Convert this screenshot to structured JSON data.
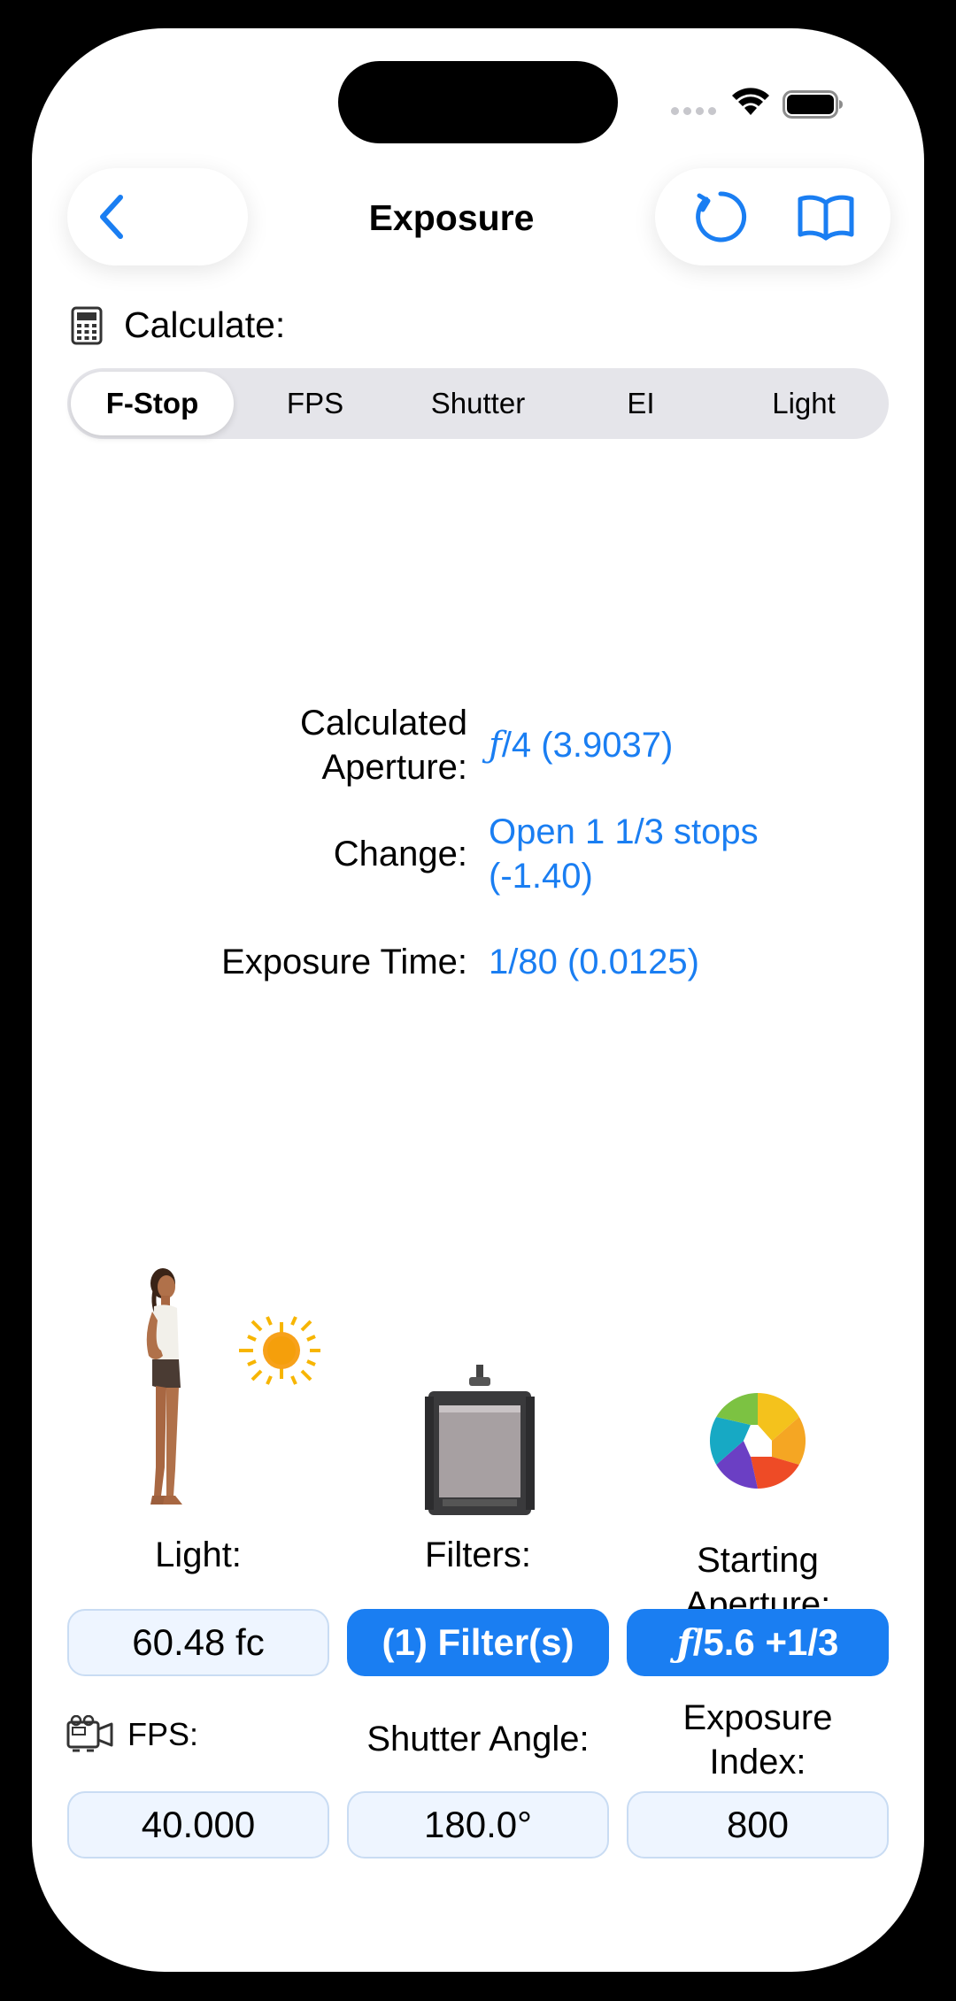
{
  "status_bar": {
    "signal_icon": "cellular-signal-icon",
    "wifi_icon": "wifi-icon",
    "battery_icon": "battery-icon"
  },
  "nav": {
    "title": "Exposure",
    "back_icon": "chevron-left-icon",
    "reset_icon": "reset-icon",
    "book_icon": "book-icon"
  },
  "calculate": {
    "label": "Calculate:",
    "icon": "calculator-icon"
  },
  "tabs": [
    {
      "label": "F-Stop",
      "selected": true
    },
    {
      "label": "FPS",
      "selected": false
    },
    {
      "label": "Shutter",
      "selected": false
    },
    {
      "label": "EI",
      "selected": false
    },
    {
      "label": "Light",
      "selected": false
    }
  ],
  "results": {
    "aperture_label_1": "Calculated",
    "aperture_label_2": "Aperture:",
    "aperture_f": "ƒ",
    "aperture_value": "/4 (3.9037)",
    "change_label": "Change:",
    "change_value_1": "Open 1 1/3 stops",
    "change_value_2": "(-1.40)",
    "exposure_time_label": "Exposure Time:",
    "exposure_time_value": "1/80 (0.0125)"
  },
  "inputs": {
    "light_label": "Light:",
    "light_value": "60.48 fc",
    "filters_label": "Filters:",
    "filters_value": "(1) Filter(s)",
    "aperture_label_1": "Starting",
    "aperture_label_2": "Aperture:",
    "aperture_f": "ƒ",
    "aperture_value": "/5.6 +1/3",
    "fps_label": "FPS:",
    "fps_icon": "camera-icon",
    "fps_value": "40.000",
    "shutter_label": "Shutter Angle:",
    "shutter_value": "180.0°",
    "ei_label_1": "Exposure",
    "ei_label_2": "Index:",
    "ei_value": "800"
  },
  "colors": {
    "accent": "#1a7ef2",
    "field_bg": "#eef5ff",
    "segment_bg": "#e5e5ea"
  }
}
